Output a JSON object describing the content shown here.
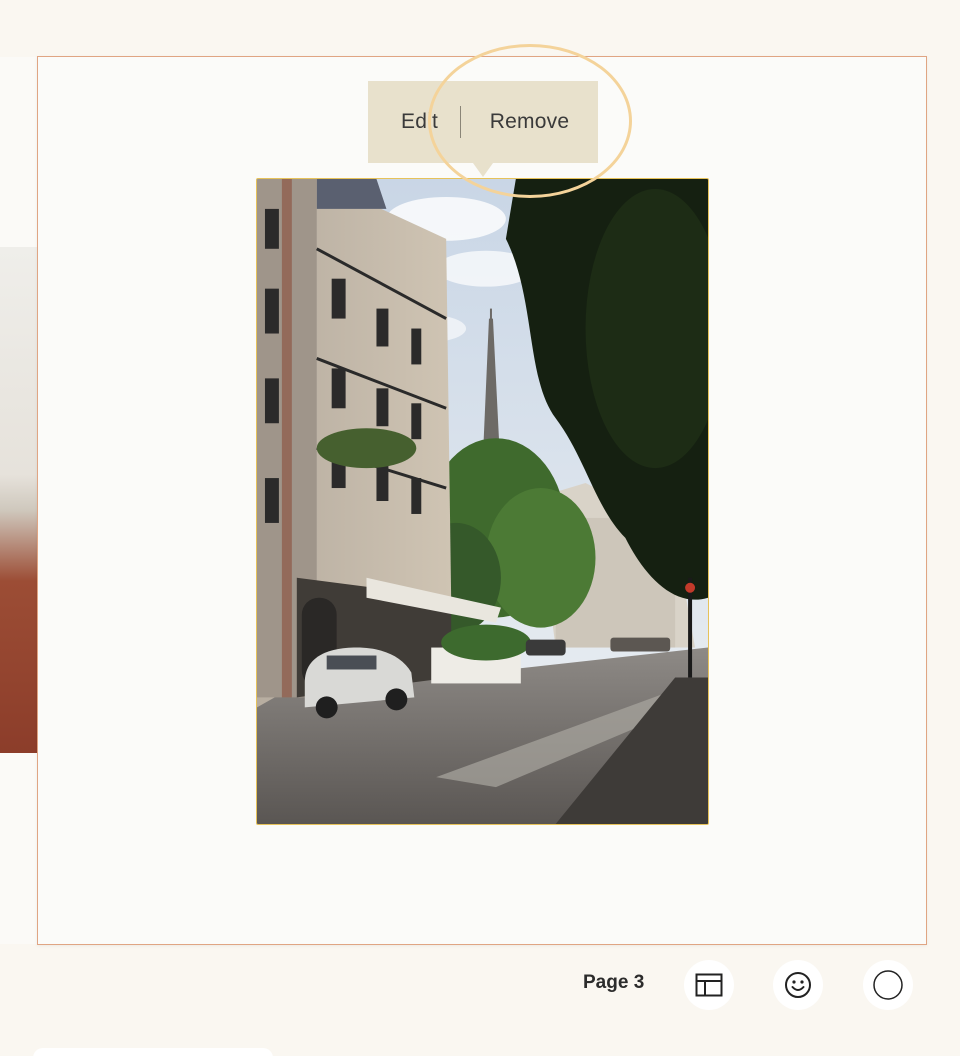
{
  "toolbar": {
    "edit_label": "Edit",
    "remove_label": "Remove"
  },
  "footer": {
    "page_label": "Page 3",
    "buttons": [
      {
        "name": "layout-icon"
      },
      {
        "name": "emoji-icon"
      },
      {
        "name": "circle-shape-icon"
      }
    ]
  },
  "colors": {
    "page_border": "#e0a583",
    "toolbar_bg": "#e8e1cc",
    "highlight": "#f4d39a",
    "frame_border": "#e6c25a",
    "background": "#faf7f1"
  }
}
